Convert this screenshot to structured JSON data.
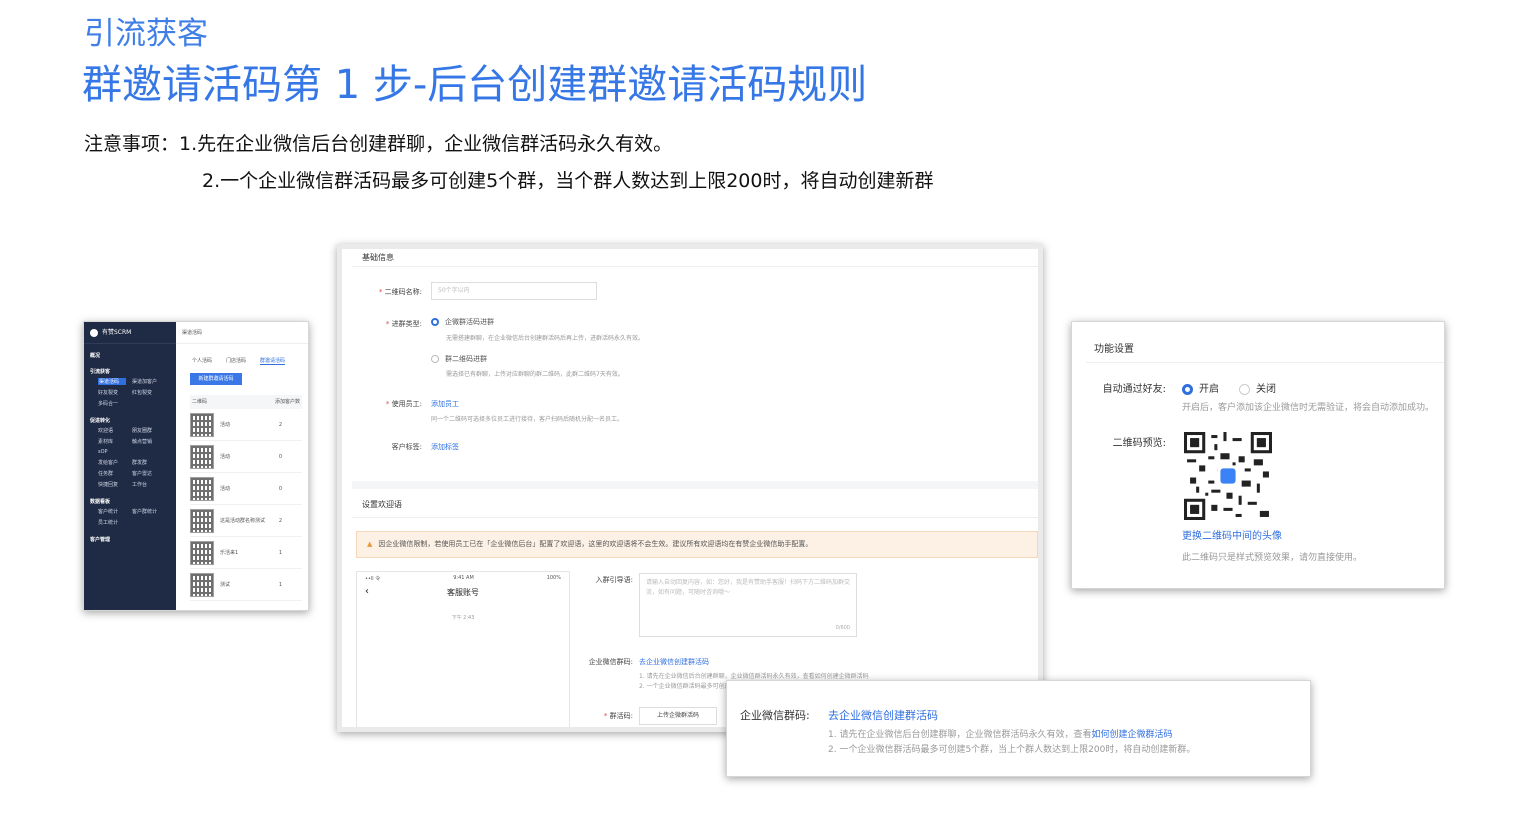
{
  "header": {
    "category": "引流获客",
    "title": "群邀请活码第 1 步-后台创建群邀请活码规则",
    "note_line1": "注意事项：1.先在企业微信后台创建群聊，企业微信群活码永久有效。",
    "note_line2": "2.一个企业微信群活码最多可创建5个群，当个群人数达到上限200时，将自动创建新群"
  },
  "shot1": {
    "brand": "有赞SCRM",
    "nav": [
      {
        "group": "概况",
        "items": []
      },
      {
        "group": "引流获客",
        "items": [
          "渠道活码",
          "渠道加客户",
          "好友裂变",
          "红包裂变",
          "多码合一"
        ]
      },
      {
        "group": "促进转化",
        "items": [
          "欢迎语",
          "朋友圈群",
          "素材库",
          "触点营销",
          "sOP",
          "发给客户",
          "群发群",
          "任务群",
          "客户雷达",
          "快捷回复",
          "群发群",
          "工作台"
        ]
      },
      {
        "group": "数据看板",
        "items": [
          "客户统计",
          "客户群统计",
          "员工统计"
        ]
      },
      {
        "group": "客户管理",
        "items": []
      }
    ],
    "crumb": "渠道活码",
    "tabs": [
      "个人活码",
      "门店活码",
      "群邀请活码"
    ],
    "active_tab": 2,
    "new_button": "新建群邀请活码",
    "columns": [
      "二维码",
      "群活码名称",
      "添加客户数"
    ],
    "rows": [
      {
        "name": "活动",
        "count": "2"
      },
      {
        "name": "活动",
        "count": "0"
      },
      {
        "name": "活动",
        "count": "0"
      },
      {
        "name": "这是活动群名称测试",
        "count": "2"
      },
      {
        "name": "乐活来1",
        "count": "1"
      },
      {
        "name": "测试",
        "count": "1"
      }
    ]
  },
  "shot2": {
    "section_basic": "基础信息",
    "name_label": "二维码名称:",
    "name_placeholder": "50个字以内",
    "type_label": "进群类型:",
    "type_option1": "企微群活码进群",
    "type_option1_desc": "无需搭建群聊，在企业微信后台创建群活码后再上传，进群活码永久有效。",
    "type_option2": "群二维码进群",
    "type_option2_desc": "需选择已有群聊，上传对应群聊的群二维码，此群二维码7天有效。",
    "staff_label": "使用员工:",
    "staff_link": "添加员工",
    "staff_desc": "同一个二维码可选择多位员工进行接待，客户扫码后随机分配一名员工。",
    "tag_label": "客户标签:",
    "tag_link": "添加标签",
    "section_welcome": "设置欢迎语",
    "warning": "因企业微信限制，若使用员工已在「企业微信后台」配置了欢迎语，这里的欢迎语将不会生效。建议所有欢迎语均在有赞企业微信助手配置。",
    "phone": {
      "signal": "••ll 令",
      "time": "9:41 AM",
      "battery": "100%",
      "title": "客服账号",
      "msg_time": "下午 2:43"
    },
    "guide_label": "入群引导语:",
    "guide_placeholder": "请输入自动回复内容，如：您好，我是有赞助手客服！扫码下方二维码加群交流，如有问题，可随时咨询哦～",
    "guide_count": "0/600",
    "group_code_label": "企业微信群码:",
    "group_code_link": "去企业微信创建群活码",
    "group_code_desc1": "1. 请先在企业微信后台创建群聊，企业微信群活码永久有效，查看如何创建企微群活码",
    "group_code_desc2": "2. 一个企业微信群活码最多可创建5个群，当上个群人数达到上限200时，将自动创建新群。",
    "qr_label": "群活码:",
    "upload_button": "上传企微群活码"
  },
  "shot3": {
    "heading": "功能设置",
    "auto_label": "自动通过好友:",
    "on_label": "开启",
    "off_label": "关闭",
    "auto_hint": "开启后，客户添加该企业微信时无需验证，将会自动添加成功。",
    "qr_label": "二维码预览:",
    "swap_link": "更换二维码中间的头像",
    "qr_hint": "此二维码只是样式预览效果，请勿直接使用。"
  },
  "shot4": {
    "label": "企业微信群码:",
    "link": "去企业微信创建群活码",
    "desc1_prefix": "1. 请先在企业微信后台创建群聊，企业微信群活码永久有效，查看",
    "desc1_link": "如何创建企微群活码",
    "desc2": "2. 一个企业微信群活码最多可创建5个群，当上个群人数达到上限200时，将自动创建新群。"
  },
  "colors": {
    "accent": "#2f6fe0",
    "title": "#3577e6",
    "sidebar": "#1f2a44",
    "warning_bg": "#fdf1e6"
  }
}
